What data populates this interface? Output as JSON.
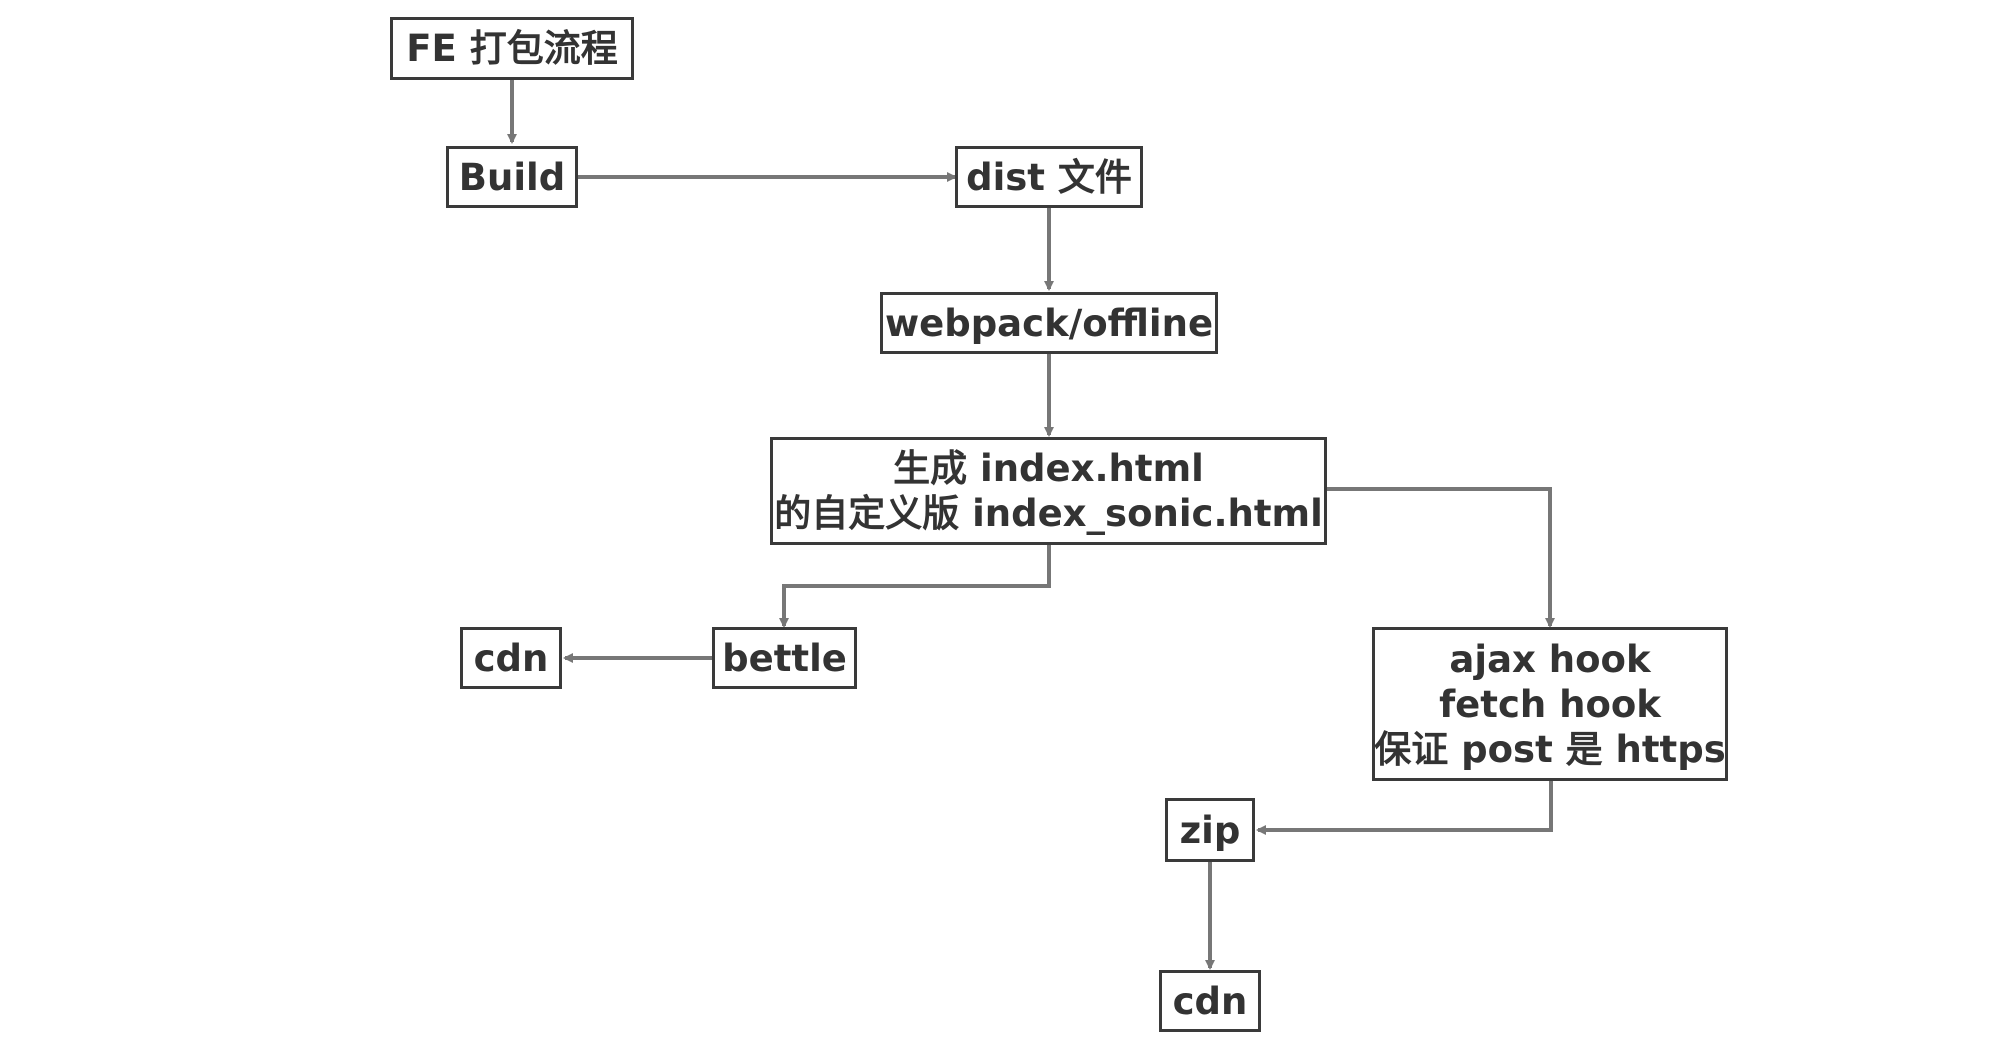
{
  "diagram": {
    "nodes": {
      "title": {
        "lines": [
          "FE 打包流程"
        ]
      },
      "build": {
        "lines": [
          "Build"
        ]
      },
      "dist": {
        "lines": [
          "dist 文件"
        ]
      },
      "webpack": {
        "lines": [
          "webpack/offline"
        ]
      },
      "generate": {
        "lines": [
          "生成 index.html",
          "的自定义版 index_sonic.html"
        ]
      },
      "bettle": {
        "lines": [
          "bettle"
        ]
      },
      "cdn_left": {
        "lines": [
          "cdn"
        ]
      },
      "hooks": {
        "lines": [
          "ajax hook",
          "fetch hook",
          "保证 post 是 https"
        ]
      },
      "zip": {
        "lines": [
          "zip"
        ]
      },
      "cdn_bottom": {
        "lines": [
          "cdn"
        ]
      }
    },
    "edges": [
      {
        "from": "title",
        "to": "build"
      },
      {
        "from": "build",
        "to": "dist"
      },
      {
        "from": "dist",
        "to": "webpack"
      },
      {
        "from": "webpack",
        "to": "generate"
      },
      {
        "from": "generate",
        "to": "bettle"
      },
      {
        "from": "generate",
        "to": "hooks"
      },
      {
        "from": "bettle",
        "to": "cdn_left"
      },
      {
        "from": "hooks",
        "to": "zip"
      },
      {
        "from": "zip",
        "to": "cdn_bottom"
      }
    ],
    "colors": {
      "edge": "#777777",
      "node_border": "#3a3a3a",
      "node_text": "#333333"
    }
  }
}
